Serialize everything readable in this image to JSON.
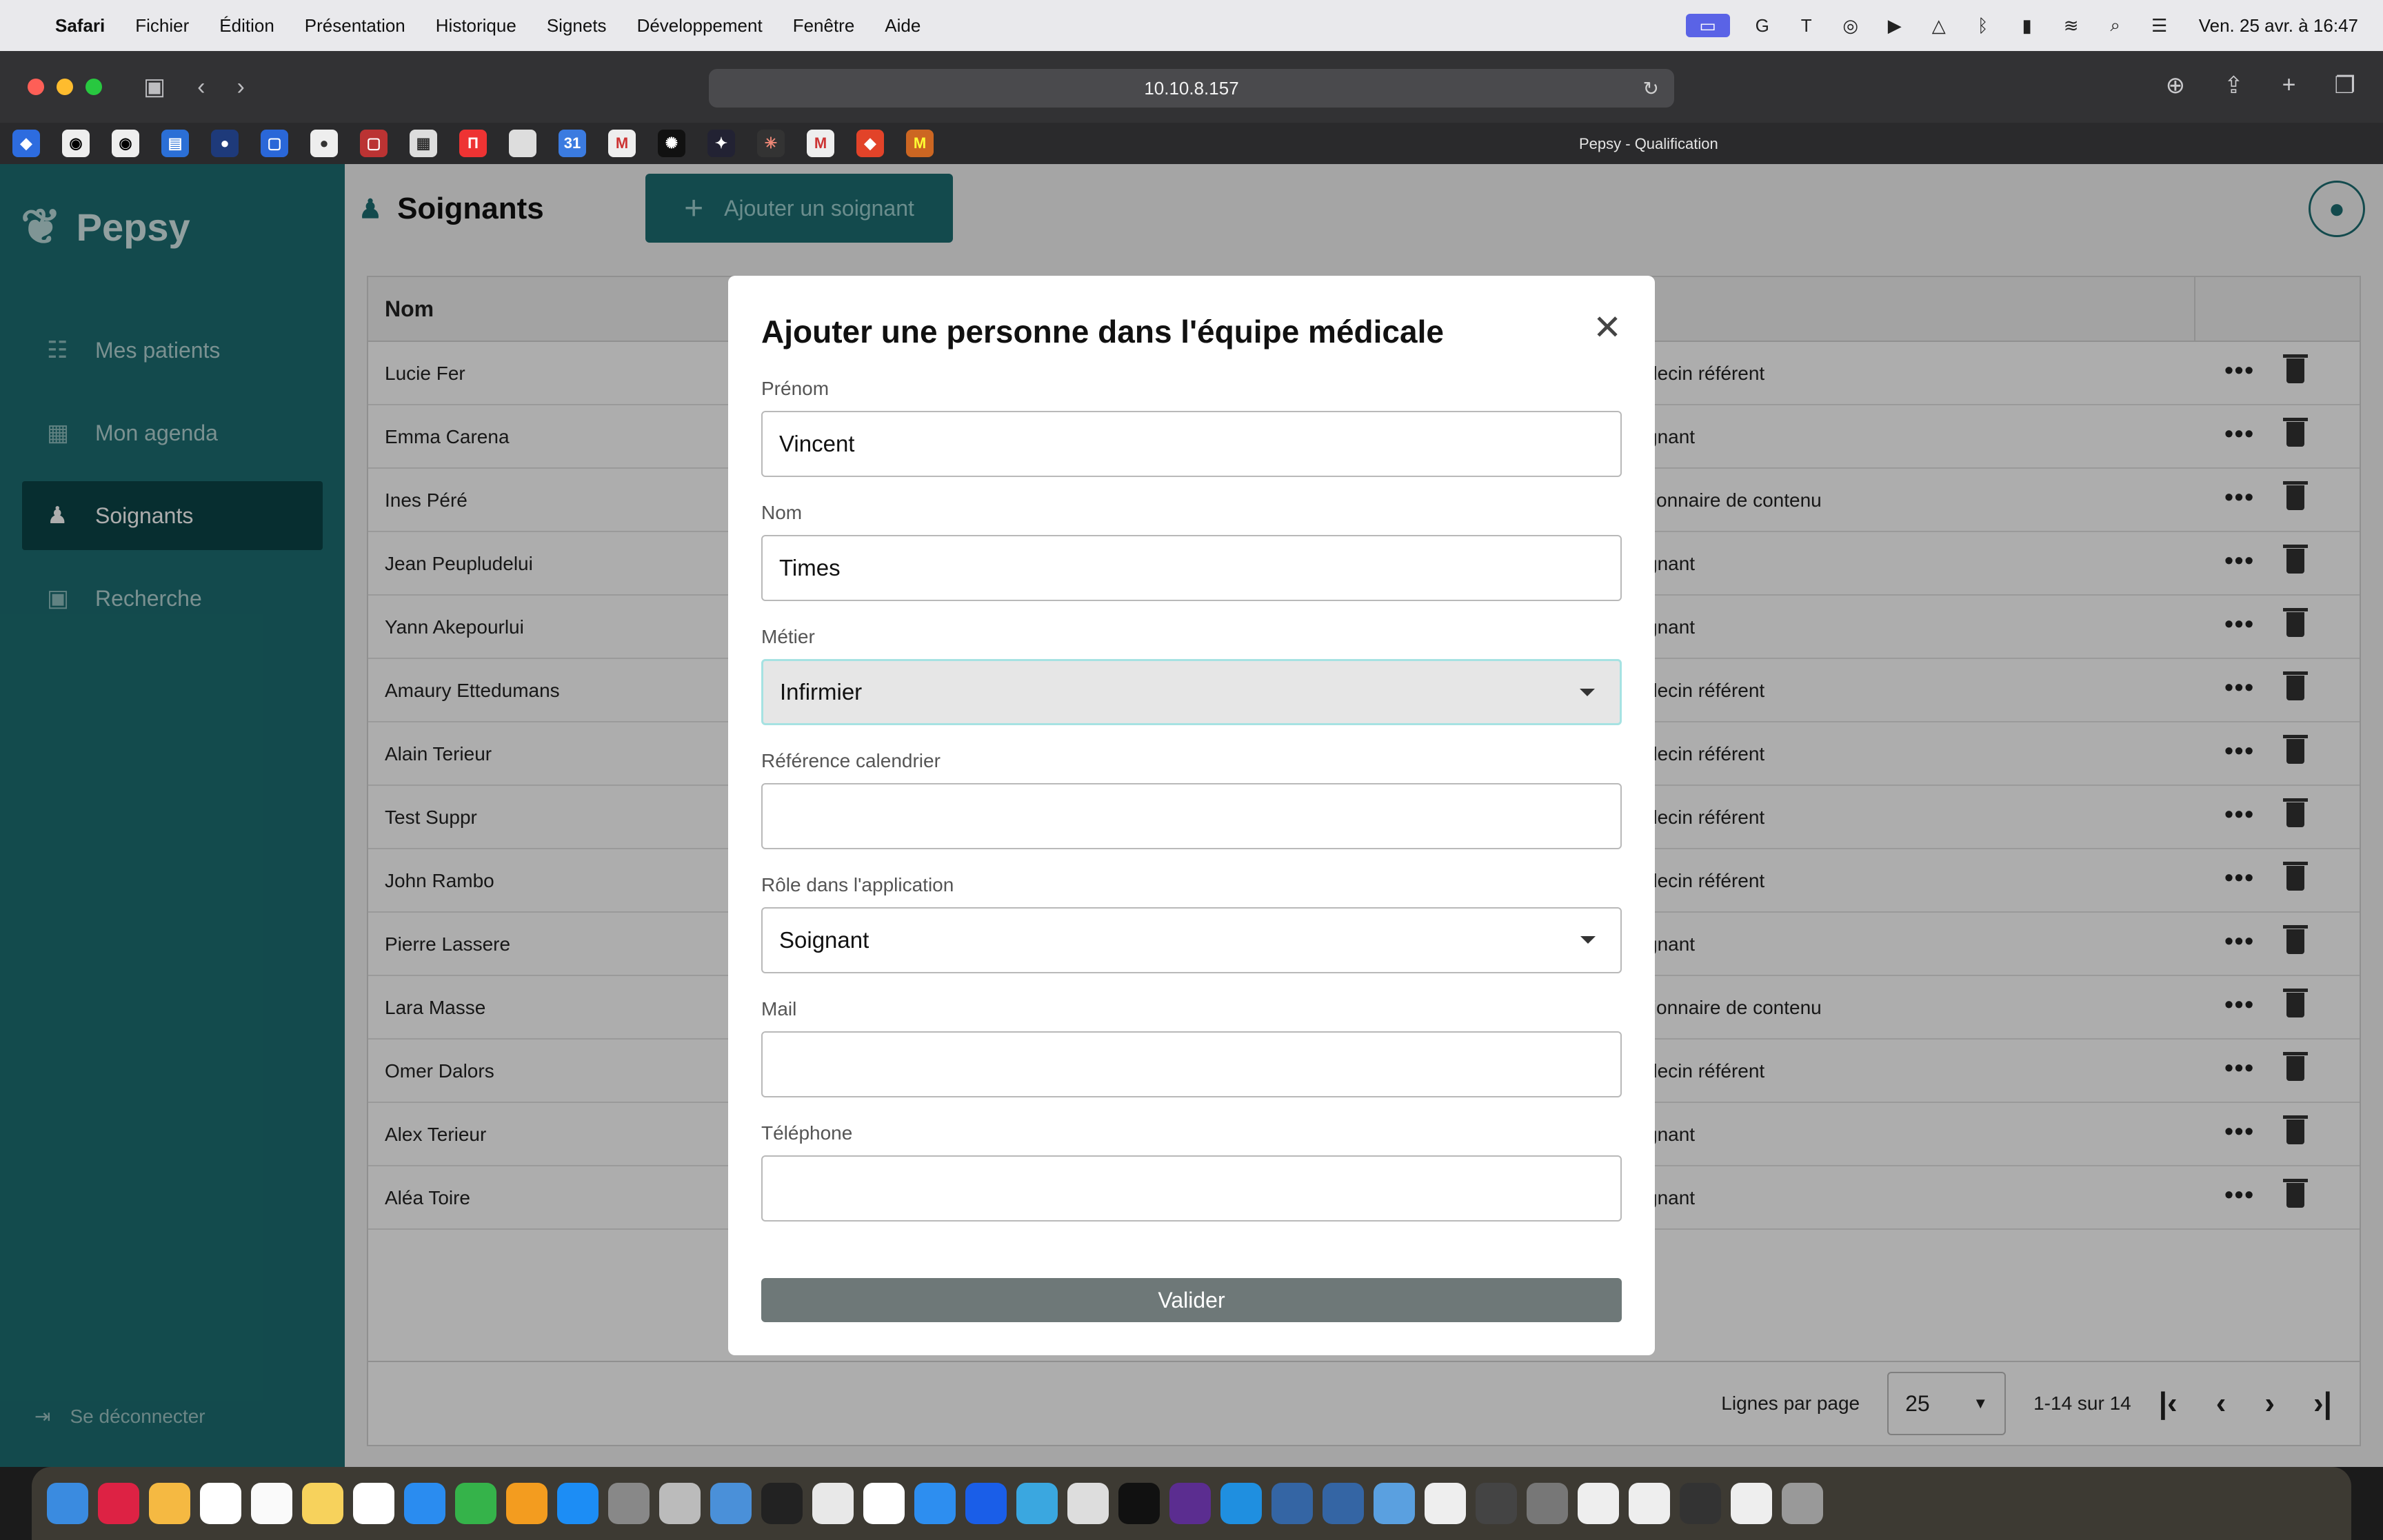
{
  "menubar": {
    "items": [
      "Safari",
      "Fichier",
      "Édition",
      "Présentation",
      "Historique",
      "Signets",
      "Développement",
      "Fenêtre",
      "Aide"
    ],
    "clock": "Ven. 25 avr. à 16:47"
  },
  "browser": {
    "url": "10.10.8.157",
    "tab_title": "Pepsy - Qualification"
  },
  "app": {
    "brand": "Pepsy",
    "nav": [
      {
        "label": "Mes patients",
        "icon": "patients-icon"
      },
      {
        "label": "Mon agenda",
        "icon": "calendar-icon"
      },
      {
        "label": "Soignants",
        "icon": "caregiver-icon",
        "active": true
      },
      {
        "label": "Recherche",
        "icon": "search-book-icon"
      }
    ],
    "logout": "Se déconnecter",
    "page_title": "Soignants",
    "add_button": "Ajouter un soignant"
  },
  "table": {
    "col_name": "Nom",
    "rows": [
      {
        "name": "Lucie Fer",
        "role": "decin référent"
      },
      {
        "name": "Emma Carena",
        "role": "gnant"
      },
      {
        "name": "Ines Péré",
        "role": "tionnaire de contenu"
      },
      {
        "name": "Jean Peupludelui",
        "role": "gnant"
      },
      {
        "name": "Yann Akepourlui",
        "role": "gnant"
      },
      {
        "name": "Amaury Ettedumans",
        "role": "decin référent"
      },
      {
        "name": "Alain Terieur",
        "role": "decin référent"
      },
      {
        "name": "Test Suppr",
        "role": "decin référent"
      },
      {
        "name": "John Rambo",
        "role": "decin référent"
      },
      {
        "name": "Pierre Lassere",
        "role": "gnant"
      },
      {
        "name": "Lara Masse",
        "role": "tionnaire de contenu"
      },
      {
        "name": "Omer Dalors",
        "role": "decin référent"
      },
      {
        "name": "Alex Terieur",
        "role": "gnant"
      },
      {
        "name": "Aléa Toire",
        "role": "gnant"
      }
    ],
    "rows_per_page_label": "Lignes par page",
    "rows_per_page": "25",
    "range": "1-14 sur 14"
  },
  "modal": {
    "title": "Ajouter une personne dans l'équipe médicale",
    "fields": {
      "prenom": {
        "label": "Prénom",
        "value": "Vincent"
      },
      "nom": {
        "label": "Nom",
        "value": "Times"
      },
      "metier": {
        "label": "Métier",
        "value": "Infirmier"
      },
      "reference": {
        "label": "Référence calendrier",
        "value": ""
      },
      "role": {
        "label": "Rôle dans l'application",
        "value": "Soignant"
      },
      "mail": {
        "label": "Mail",
        "value": ""
      },
      "telephone": {
        "label": "Téléphone",
        "value": ""
      }
    },
    "submit": "Valider"
  },
  "colors": {
    "brand": "#1c6e72",
    "sidebar_active": "#0b4447",
    "submit": "#6e7878",
    "focus_border": "#a6e2e2"
  }
}
